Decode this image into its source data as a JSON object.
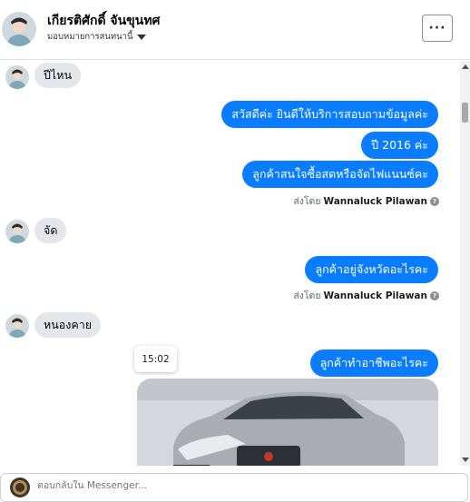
{
  "header": {
    "name": "เกียรติศักดิ์ จันขุนทศ",
    "assign_label": "มอบหมายการสนทนานี้",
    "more_label": "···"
  },
  "messages": [
    {
      "from": "customer",
      "text": "ปีไหน"
    },
    {
      "from": "page",
      "text": "สวัสดีค่ะ  ยินดีให้บริการสอบถามข้อมูลค่ะ"
    },
    {
      "from": "page",
      "text": "ปี 2016  ค่ะ"
    },
    {
      "from": "page",
      "text": "ลูกค้าสนใจซื้อสดหรือจัดไฟแนนซ์คะ"
    },
    {
      "from": "meta",
      "prefix": "ส่งโดย",
      "sender": "Wannaluck Pilawan"
    },
    {
      "from": "customer",
      "text": "จัด"
    },
    {
      "from": "page",
      "text": "ลูกค้าอยู่จังหวัดอะไรคะ"
    },
    {
      "from": "meta",
      "prefix": "ส่งโดย",
      "sender": "Wannaluck Pilawan"
    },
    {
      "from": "customer",
      "text": "หนองคาย"
    },
    {
      "from": "page",
      "text": "ลูกค้าทำอาชีพอะไรคะ"
    }
  ],
  "timestamp_tooltip": "15:02",
  "info_icon": "?",
  "composer": {
    "placeholder": "ตอบกลับใน Messenger..."
  },
  "colors": {
    "outgoing_bubble": "#0a7cff",
    "incoming_bubble": "#e4e6eb"
  },
  "icons": [
    "avatar",
    "chevron-down-icon",
    "more-icon",
    "info-icon",
    "scroll-up-icon",
    "scroll-down-icon"
  ]
}
